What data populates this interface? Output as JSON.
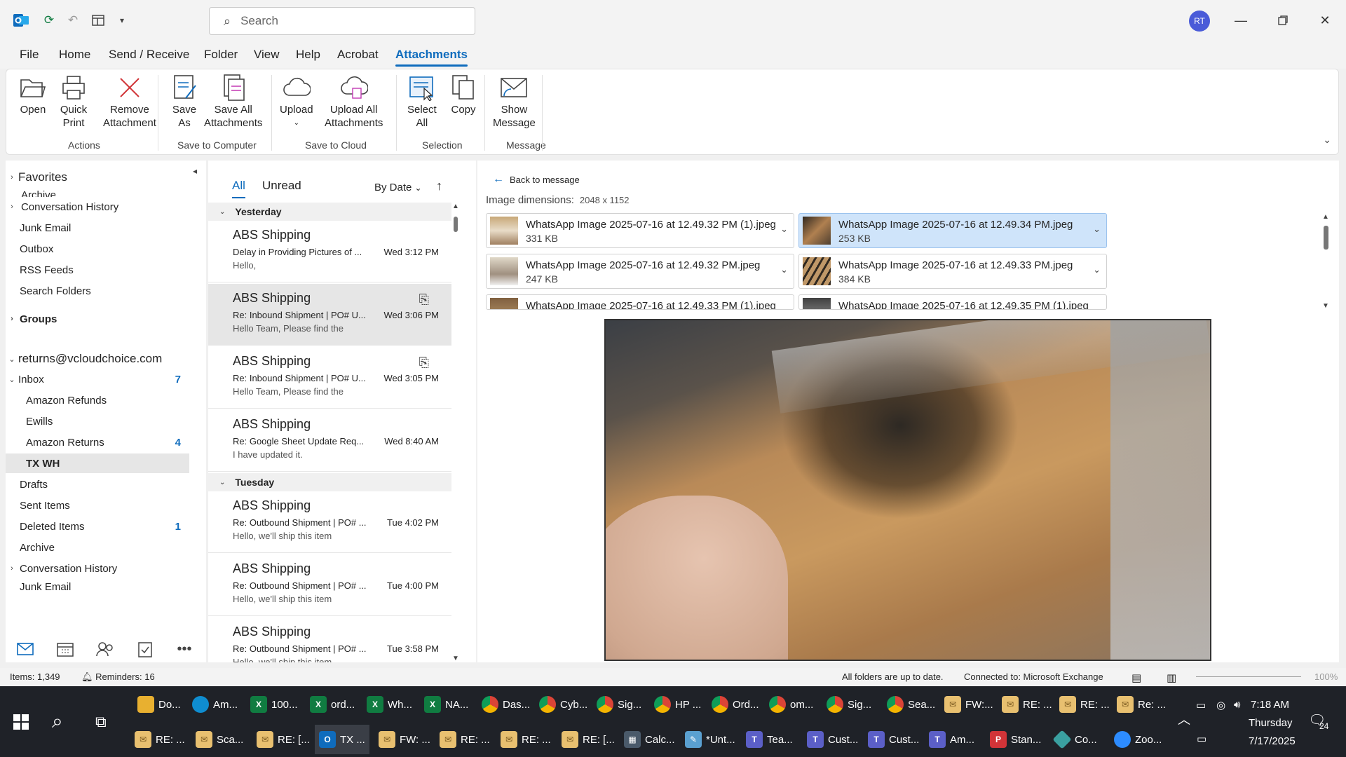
{
  "titlebar": {
    "search_placeholder": "Search",
    "avatar_initials": "RT"
  },
  "menu": {
    "tabs": [
      "File",
      "Home",
      "Send / Receive",
      "Folder",
      "View",
      "Help",
      "Acrobat",
      "Attachments"
    ],
    "active": "Attachments"
  },
  "ribbon": {
    "open": "Open",
    "quick_print_1": "Quick",
    "quick_print_2": "Print",
    "remove_1": "Remove",
    "remove_2": "Attachment",
    "save_as_1": "Save",
    "save_as_2": "As",
    "save_all_1": "Save All",
    "save_all_2": "Attachments",
    "upload": "Upload",
    "upload_all_1": "Upload All",
    "upload_all_2": "Attachments",
    "select_all_1": "Select",
    "select_all_2": "All",
    "copy": "Copy",
    "show_message_1": "Show",
    "show_message_2": "Message",
    "groups": [
      "Actions",
      "Save to Computer",
      "Save to Cloud",
      "Selection",
      "Message"
    ]
  },
  "folders": {
    "favorites": "Favorites",
    "items_top": [
      {
        "label": "Archive"
      },
      {
        "label": "Conversation History",
        "chevron": true
      },
      {
        "label": "Junk Email"
      },
      {
        "label": "Outbox"
      },
      {
        "label": "RSS Feeds"
      },
      {
        "label": "Search Folders"
      }
    ],
    "groups": "Groups",
    "account": "returns@vcloudchoice.com",
    "inbox": "Inbox",
    "inbox_count": "7",
    "subfolders": [
      {
        "label": "Amazon Refunds",
        "count": ""
      },
      {
        "label": "Ewills",
        "count": ""
      },
      {
        "label": "Amazon Returns",
        "count": "4"
      },
      {
        "label": "TX WH",
        "count": ""
      }
    ],
    "items_bottom": [
      {
        "label": "Drafts",
        "count": ""
      },
      {
        "label": "Sent Items",
        "count": ""
      },
      {
        "label": "Deleted Items",
        "count": "1"
      },
      {
        "label": "Archive",
        "count": ""
      },
      {
        "label": "Conversation History",
        "count": ""
      },
      {
        "label": "Junk Email",
        "count": ""
      }
    ]
  },
  "msglist": {
    "tab_all": "All",
    "tab_unread": "Unread",
    "sort": "By Date",
    "group_yesterday": "Yesterday",
    "group_tuesday": "Tuesday",
    "messages": [
      {
        "from": "ABS Shipping",
        "subject": "Delay in Providing Pictures of ...",
        "time": "Wed 3:12 PM",
        "preview": "Hello,"
      },
      {
        "from": "ABS Shipping",
        "subject": "Re: Inbound Shipment | PO# U...",
        "time": "Wed 3:06 PM",
        "preview": "Hello Team,  Please find the"
      },
      {
        "from": "ABS Shipping",
        "subject": "Re: Inbound Shipment | PO# U...",
        "time": "Wed 3:05 PM",
        "preview": "Hello Team,  Please find the"
      },
      {
        "from": "ABS Shipping",
        "subject": "Re: Google Sheet Update Req...",
        "time": "Wed 8:40 AM",
        "preview": "I have updated it."
      },
      {
        "from": "ABS Shipping",
        "subject": "Re: Outbound Shipment | PO# ...",
        "time": "Tue 4:02 PM",
        "preview": "Hello,  we'll ship this item"
      },
      {
        "from": "ABS Shipping",
        "subject": "Re: Outbound Shipment | PO# ...",
        "time": "Tue 4:00 PM",
        "preview": "Hello,  we'll ship this item"
      },
      {
        "from": "ABS Shipping",
        "subject": "Re: Outbound Shipment | PO# ...",
        "time": "Tue 3:58 PM",
        "preview": "Hello,  we'll ship this item"
      }
    ]
  },
  "reading": {
    "back": "Back to message",
    "dim_label": "Image dimensions:",
    "dim_value": "2048 x 1152",
    "attachments": [
      {
        "name": "WhatsApp Image 2025-07-16 at 12.49.32 PM (1).jpeg",
        "size": "331 KB"
      },
      {
        "name": "WhatsApp Image 2025-07-16 at 12.49.34 PM.jpeg",
        "size": "253 KB"
      },
      {
        "name": "WhatsApp Image 2025-07-16 at 12.49.32 PM.jpeg",
        "size": "247 KB"
      },
      {
        "name": "WhatsApp Image 2025-07-16 at 12.49.33 PM.jpeg",
        "size": "384 KB"
      },
      {
        "name": "WhatsApp Image 2025-07-16 at 12.49.33 PM (1).jpeg",
        "size": ""
      },
      {
        "name": "WhatsApp Image 2025-07-16 at 12.49.35 PM (1).jpeg",
        "size": ""
      }
    ]
  },
  "status": {
    "items": "Items: 1,349",
    "reminders": "Reminders: 16",
    "sync": "All folders are up to date.",
    "connected": "Connected to: Microsoft Exchange",
    "zoom": "100%"
  },
  "taskbar": {
    "row1": [
      "Do...",
      "Am...",
      "100...",
      "ord...",
      "Wh...",
      "NA...",
      "Das...",
      "Cyb...",
      "Sig...",
      "HP ...",
      "Ord...",
      "om...",
      "Sig...",
      "Sea...",
      "FW:...",
      "RE: ...",
      "RE: ...",
      "Re: ..."
    ],
    "row2": [
      "RE: ...",
      "Sca...",
      "RE: [...",
      "TX ...",
      "FW: ...",
      "RE: ...",
      "RE: ...",
      "RE: [...",
      "Calc...",
      "*Unt...",
      "Tea...",
      "Cust...",
      "Cust...",
      "Am...",
      "Stan...",
      "Co...",
      "Zoo..."
    ],
    "time": "7:18 AM",
    "day": "Thursday",
    "date": "7/17/2025",
    "notif": "24"
  },
  "colors": {
    "accent": "#0f6cbd",
    "selected_attachment": "#cfe4fa",
    "taskbar": "#1f2228"
  }
}
